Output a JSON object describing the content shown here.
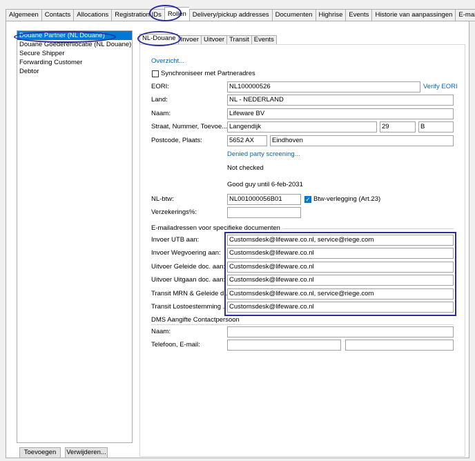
{
  "top_tabs": [
    "Algemeen",
    "Contacts",
    "Allocations",
    "Registration IDs",
    "Rollen",
    "Delivery/pickup addresses",
    "Documenten",
    "Highrise",
    "Events",
    "Historie van aanpassingen",
    "E-mail"
  ],
  "roles": [
    "Douane Partner (NL Douane)",
    "Douane Goederenlocatie (NL Douane)",
    "Secure Shipper",
    "Forwarding Customer",
    "Debtor"
  ],
  "buttons": {
    "add": "Toevoegen",
    "delete": "Verwijderen..."
  },
  "sub_tabs": [
    "NL-Douane",
    "Invoer",
    "Uitvoer",
    "Transit",
    "Events"
  ],
  "form": {
    "overview_link": "Overzicht...",
    "sync_label": "Synchroniseer met Partneradres",
    "eori_label": "EORI:",
    "eori_value": "NL100000526",
    "verify_eori": "Verify EORI",
    "country_label": "Land:",
    "country_value": "NL - NEDERLAND",
    "name_label": "Naam:",
    "name_value": "Lifeware BV",
    "street_label": "Straat, Nummer, Toevoe...",
    "street_value": "Langendijk",
    "number_value": "29",
    "suffix_value": "B",
    "postal_label": "Postcode, Plaats:",
    "postal_value": "5652 AX",
    "city_value": "Eindhoven",
    "denied_link": "Denied party screening...",
    "not_checked": "Not checked",
    "good_guy": "Good guy until 6-feb-2031",
    "vat_label": "NL-btw:",
    "vat_value": "NL001000056B01",
    "reverse_charge_label": "Btw-verlegging (Art.23)",
    "insurance_label": "Verzekerings%:",
    "insurance_value": ""
  },
  "email_group": {
    "title": "E-mailadressen voor specifieke documenten",
    "rows": [
      {
        "label": "Invoer UTB aan:",
        "value": "Customsdesk@lifeware.co.nl, service@riege.com"
      },
      {
        "label": "Invoer Wegvoering aan:",
        "value": "Customsdesk@lifeware.co.nl"
      },
      {
        "label": "Uitvoer Geleide doc. aan:",
        "value": "Customsdesk@lifeware.co.nl"
      },
      {
        "label": "Uitvoer Uitgaan doc. aan:",
        "value": "Customsdesk@lifeware.co.nl"
      },
      {
        "label": "Transit MRN & Geleide d...",
        "value": "Customsdesk@lifeware.co.nl, service@riege.com"
      },
      {
        "label": "Transit Lostoestemming ...",
        "value": "Customsdesk@lifeware.co.nl"
      }
    ]
  },
  "dms_group": {
    "title": "DMS Aangifte Contactpersoon",
    "name_label": "Naam:",
    "name_value": "",
    "phone_label": "Telefoon, E-mail:",
    "phone_value": "",
    "email_value": ""
  },
  "colors": {
    "selection": "#0078d7",
    "highlight": "#2d2b9a",
    "link": "#0066cc"
  }
}
